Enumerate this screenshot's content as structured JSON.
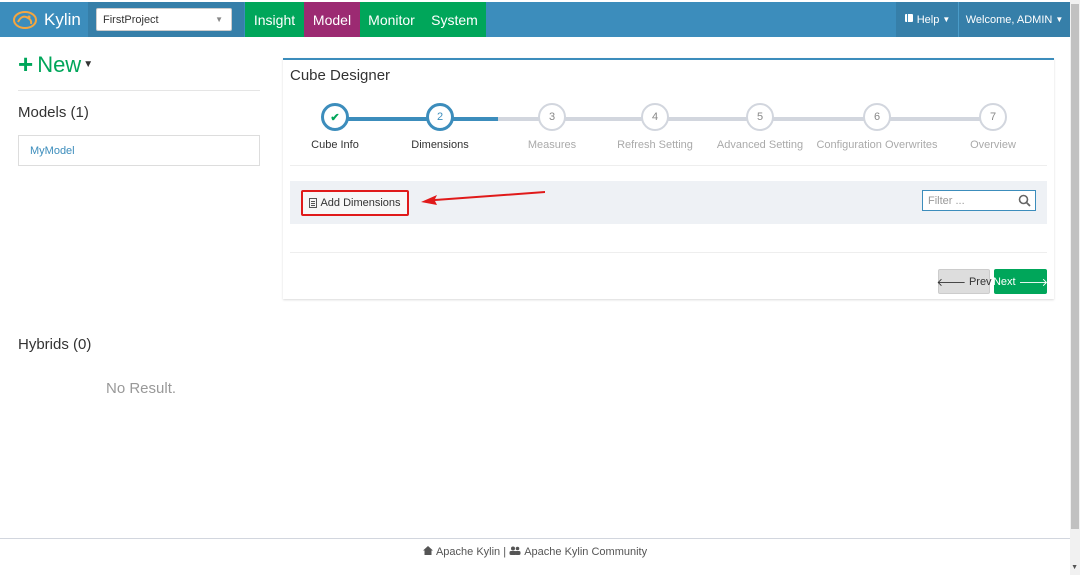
{
  "navbar": {
    "brand": "Kylin",
    "project": "FirstProject",
    "tabs": [
      {
        "label": "Insight"
      },
      {
        "label": "Model"
      },
      {
        "label": "Monitor"
      },
      {
        "label": "System"
      }
    ],
    "help_label": "Help",
    "user_label": "Welcome, ADMIN",
    "colors": {
      "navbar": "#3c8dbc",
      "active_tab": "#9c2a72",
      "tab": "#00a65a"
    }
  },
  "sidebar": {
    "new_label": "New",
    "models_heading": "Models (1)",
    "models": [
      {
        "label": "MyModel"
      }
    ],
    "hybrids_heading": "Hybrids (0)",
    "no_result": "No Result."
  },
  "designer": {
    "title": "Cube Designer",
    "steps": [
      {
        "number": "✔",
        "label": "Cube Info",
        "state": "done"
      },
      {
        "number": "2",
        "label": "Dimensions",
        "state": "active"
      },
      {
        "number": "3",
        "label": "Measures",
        "state": "todo"
      },
      {
        "number": "4",
        "label": "Refresh Setting",
        "state": "todo"
      },
      {
        "number": "5",
        "label": "Advanced Setting",
        "state": "todo"
      },
      {
        "number": "6",
        "label": "Configuration Overwrites",
        "state": "todo"
      },
      {
        "number": "7",
        "label": "Overview",
        "state": "todo"
      }
    ],
    "add_dimensions_label": "Add Dimensions",
    "filter_placeholder": "Filter ...",
    "prev_label": "Prev",
    "next_label": "Next"
  },
  "footer": {
    "left_link": "Apache Kylin",
    "separator": "|",
    "right_link": "Apache Kylin Community"
  }
}
